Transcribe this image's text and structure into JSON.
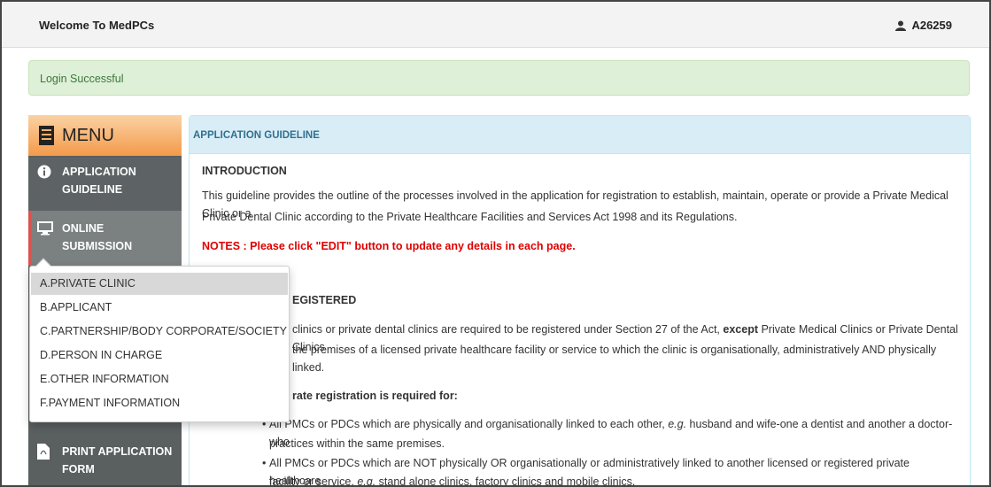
{
  "header": {
    "title": "Welcome To MedPCs",
    "user_id": "A26259",
    "user_icon": "user-icon"
  },
  "alert": {
    "text": "Login Successful",
    "color": "#dff0d8"
  },
  "sidebar": {
    "menu_label": "MENU",
    "menu_icon": "document-icon",
    "items": [
      {
        "line1": "APPLICATION",
        "line2": "GUIDELINE",
        "icon": "info-icon"
      },
      {
        "line1": "ONLINE",
        "line2": "SUBMISSION",
        "icon": "monitor-icon"
      },
      {
        "line1": "PRINT APPLICATION",
        "line2": "FORM",
        "icon": "pdf-icon"
      }
    ]
  },
  "dropdown": {
    "items": [
      "A.PRIVATE CLINIC",
      "B.APPLICANT",
      "C.PARTNERSHIP/BODY CORPORATE/SOCIETY",
      "D.PERSON IN CHARGE",
      "E.OTHER INFORMATION",
      "F.PAYMENT INFORMATION"
    ],
    "selected": "A.PRIVATE CLINIC"
  },
  "panel": {
    "title": "APPLICATION GUIDELINE",
    "intro_heading": "INTRODUCTION",
    "intro_line1": "This guideline provides the outline of the processes involved in the application for registration to establish, maintain, operate or provide a Private Medical Clinic or a",
    "intro_line2": "Private Dental Clinic according to the Private Healthcare Facilities and Services Act 1998 and its Regulations.",
    "notes": "NOTES : Please click \"EDIT\" button to update any details in each page.",
    "registered_heading": "EGISTERED",
    "reg_line1_a": "clinics or private dental clinics are required to be registered under Section 27 of the Act, ",
    "reg_line1_b": "except",
    "reg_line1_c": " Private Medical Clinics or Private Dental Clinics",
    "reg_line2": "the premises of a licensed private healthcare facility or service to which the clinic is organisationally, administratively AND physically linked.",
    "separate_heading": "rate registration is required for:",
    "bullet1_a": "All PMCs or PDCs which are physically and organisationally linked to each other, ",
    "bullet1_eg": "e.g.",
    "bullet1_b": " husband and wife-one a dentist and another a doctor-who",
    "bullet1_line2": "practices within the same premises.",
    "bullet2_line1": "All PMCs or PDCs which are NOT physically OR organisationally or administratively linked to another licensed or registered private healthcare",
    "bullet2_a": "facility or service, ",
    "bullet2_eg": "e.g.",
    "bullet2_b": " stand alone clinics, factory clinics and mobile clinics."
  }
}
